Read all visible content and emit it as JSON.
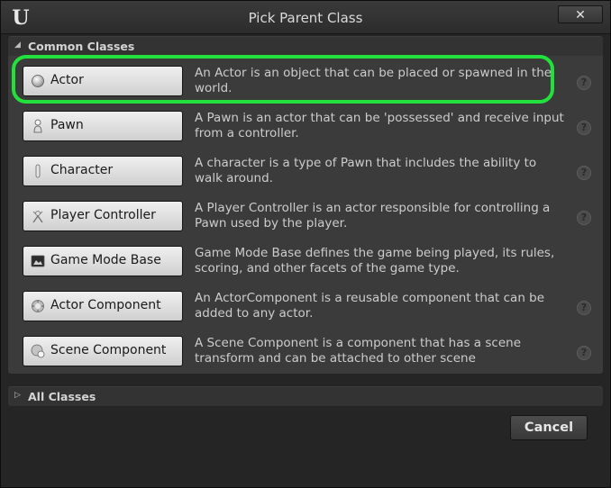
{
  "window": {
    "title": "Pick Parent Class",
    "logo": "U",
    "close_glyph": "✕"
  },
  "common": {
    "header": "Common Classes",
    "items": [
      {
        "label": "Actor",
        "icon": "actor-sphere-icon",
        "description": "An Actor is an object that can be placed or spawned in the world.",
        "help": "?"
      },
      {
        "label": "Pawn",
        "icon": "pawn-icon",
        "description": "A Pawn is an actor that can be 'possessed' and receive input from a controller.",
        "help": "?"
      },
      {
        "label": "Character",
        "icon": "character-icon",
        "description": "A character is a type of Pawn that includes the ability to walk around.",
        "help": "?"
      },
      {
        "label": "Player Controller",
        "icon": "player-controller-icon",
        "description": "A Player Controller is an actor responsible for controlling a Pawn used by the player.",
        "help": "?"
      },
      {
        "label": "Game Mode Base",
        "icon": "game-mode-icon",
        "description": "Game Mode Base defines the game being played, its rules, scoring, and other facets of the game type.",
        "help": ""
      },
      {
        "label": "Actor Component",
        "icon": "actor-component-icon",
        "description": "An ActorComponent is a reusable component that can be added to any actor.",
        "help": "?"
      },
      {
        "label": "Scene Component",
        "icon": "scene-component-icon",
        "description": "A Scene Component is a component that has a scene transform and can be attached to other scene",
        "help": "?"
      }
    ]
  },
  "all_classes": {
    "header": "All Classes"
  },
  "footer": {
    "cancel_label": "Cancel"
  },
  "colors": {
    "highlight": "#22e13b",
    "button_face": "#e4e4e4",
    "panel": "#3b3b3b",
    "background": "#252525"
  }
}
